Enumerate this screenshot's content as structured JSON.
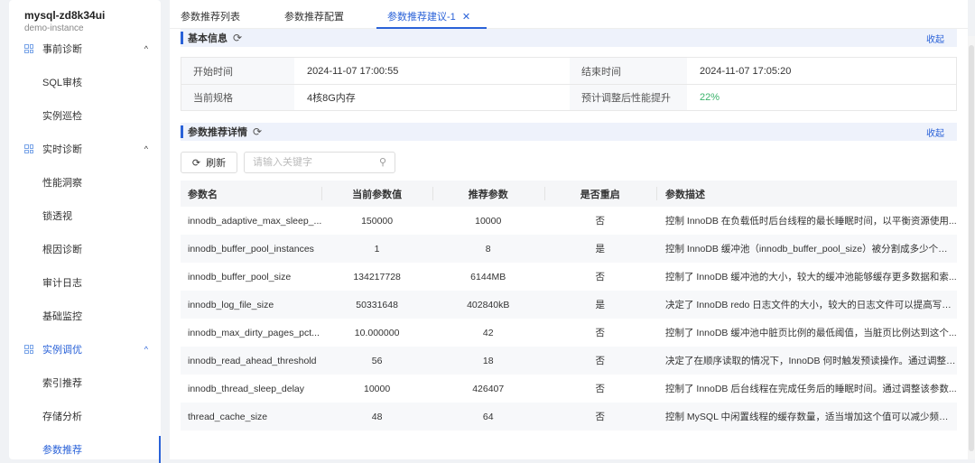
{
  "sidebar": {
    "instance_name": "mysql-zd8k34ui",
    "instance_sub": "demo-instance",
    "items": [
      {
        "label": "事前诊断",
        "type": "group"
      },
      {
        "label": "SQL审核",
        "type": "sub"
      },
      {
        "label": "实例巡检",
        "type": "sub"
      },
      {
        "label": "实时诊断",
        "type": "group"
      },
      {
        "label": "性能洞察",
        "type": "sub"
      },
      {
        "label": "锁透视",
        "type": "sub"
      },
      {
        "label": "根因诊断",
        "type": "sub"
      },
      {
        "label": "审计日志",
        "type": "sub"
      },
      {
        "label": "基础监控",
        "type": "sub"
      },
      {
        "label": "实例调优",
        "type": "group"
      },
      {
        "label": "索引推荐",
        "type": "sub"
      },
      {
        "label": "存储分析",
        "type": "sub"
      },
      {
        "label": "参数推荐",
        "type": "sub"
      }
    ]
  },
  "tabs": [
    "参数推荐列表",
    "参数推荐配置",
    "参数推荐建议-1"
  ],
  "basic": {
    "title": "基本信息",
    "collapse": "收起",
    "start_label": "开始时间",
    "start": "2024-11-07 17:00:55",
    "end_label": "结束时间",
    "end": "2024-11-07 17:05:20",
    "spec_label": "当前规格",
    "spec": "4核8G内存",
    "gain_label": "预计调整后性能提升",
    "gain": "22%"
  },
  "detail": {
    "title": "参数推荐详情",
    "collapse": "收起",
    "refresh": "刷新",
    "search_placeholder": "请输入关键字",
    "columns": [
      "参数名",
      "当前参数值",
      "推荐参数",
      "是否重启",
      "参数描述"
    ],
    "rows": [
      [
        "innodb_adaptive_max_sleep_...",
        "150000",
        "10000",
        "否",
        "控制 InnoDB 在负载低时后台线程的最长睡眠时间，以平衡资源使用..."
      ],
      [
        "innodb_buffer_pool_instances",
        "1",
        "8",
        "是",
        "控制 InnoDB 缓冲池（innodb_buffer_pool_size）被分割成多少个实例..."
      ],
      [
        "innodb_buffer_pool_size",
        "134217728",
        "6144MB",
        "否",
        "控制了 InnoDB 缓冲池的大小，较大的缓冲池能够缓存更多数据和索..."
      ],
      [
        "innodb_log_file_size",
        "50331648",
        "402840kB",
        "是",
        "决定了 InnoDB redo 日志文件的大小，较大的日志文件可以提高写入..."
      ],
      [
        "innodb_max_dirty_pages_pct...",
        "10.000000",
        "42",
        "否",
        "控制了 InnoDB 缓冲池中脏页比例的最低阈值，当脏页比例达到这个..."
      ],
      [
        "innodb_read_ahead_threshold",
        "56",
        "18",
        "否",
        "决定了在顺序读取的情况下，InnoDB 何时触发预读操作。通过调整这..."
      ],
      [
        "innodb_thread_sleep_delay",
        "10000",
        "426407",
        "否",
        "控制了 InnoDB 后台线程在完成任务后的睡眠时间。通过调整该参数..."
      ],
      [
        "thread_cache_size",
        "48",
        "64",
        "否",
        "控制 MySQL 中闲置线程的缓存数量，适当增加这个值可以减少频繁创..."
      ]
    ]
  }
}
